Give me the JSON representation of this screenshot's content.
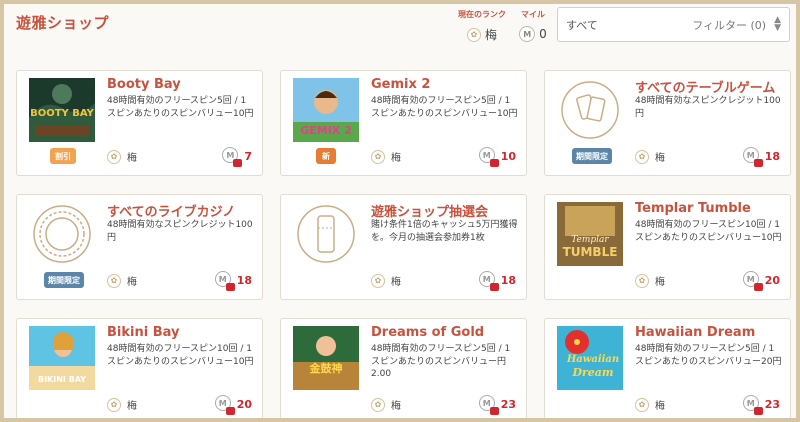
{
  "header": {
    "title": "遊雅ショップ",
    "rank_label": "現在のランク",
    "rank_value": "梅",
    "mile_label": "マイル",
    "mile_value": "0",
    "filter_all": "すべて",
    "filter_label": "フィルター (0)"
  },
  "items": [
    {
      "title": "Booty Bay",
      "desc": "48時間有効のフリースピン5回 / 1スピンあたりのスピンバリュー10円",
      "badge": "割引",
      "rank": "梅",
      "cost": "7"
    },
    {
      "title": "Gemix 2",
      "desc": "48時間有効のフリースピン5回 / 1スピンあたりのスピンバリュー10円",
      "badge": "新",
      "rank": "梅",
      "cost": "10"
    },
    {
      "title": "すべてのテーブルゲーム",
      "desc": "48時間有効なスピンクレジット100円",
      "badge": "期間限定",
      "rank": "梅",
      "cost": "18"
    },
    {
      "title": "すべてのライブカジノ",
      "desc": "48時間有効なスピンクレジット100円",
      "badge": "期間限定",
      "rank": "梅",
      "cost": "18"
    },
    {
      "title": "遊雅ショップ抽選会",
      "desc": "賭け条件1倍のキャッシュ5万円獲得を。今月の抽選会参加券1枚",
      "badge": "",
      "rank": "梅",
      "cost": "18"
    },
    {
      "title": "Templar Tumble",
      "desc": "48時間有効のフリースピン10回 / 1スピンあたりのスピンバリュー10円",
      "badge": "",
      "rank": "梅",
      "cost": "20"
    },
    {
      "title": "Bikini Bay",
      "desc": "48時間有効のフリースピン10回 / 1スピンあたりのスピンバリュー10円",
      "badge": "",
      "rank": "梅",
      "cost": "20"
    },
    {
      "title": "Dreams of Gold",
      "desc": "48時間有効のフリースピン5回 / 1スピンあたりのスピンバリュー円2.00",
      "badge": "",
      "rank": "梅",
      "cost": "23"
    },
    {
      "title": "Hawaiian Dream",
      "desc": "48時間有効のフリースピン5回 / 1スピンあたりのスピンバリュー20円",
      "badge": "",
      "rank": "梅",
      "cost": "23"
    }
  ],
  "thumb_text": {
    "booty_bay": "BOOTY BAY",
    "gemix": "GEMIX 2",
    "templar_top": "Templar",
    "templar_bottom": "TUMBLE",
    "bikini": "BIKINI BAY",
    "dreams": "金鼓神",
    "hawaiian_top": "Hawaiian",
    "hawaiian_bottom": "Dream"
  },
  "colors": {
    "accent": "#c7523e",
    "badge_sale": "#f3a24f",
    "badge_new": "#e97c33",
    "badge_limited": "#5b86a8",
    "cost_red": "#d0262e"
  }
}
